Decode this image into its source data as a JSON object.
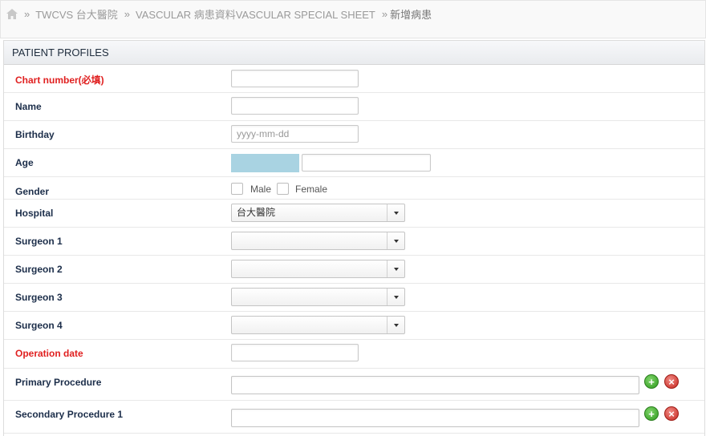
{
  "breadcrumb": {
    "items": [
      "TWCVS 台大醫院",
      "VASCULAR 病患資料VASCULAR SPECIAL SHEET"
    ],
    "current": "新增病患",
    "separator": "»"
  },
  "panel": {
    "title": "PATIENT PROFILES"
  },
  "fields": {
    "chart_number": {
      "label": "Chart number(必填)",
      "value": ""
    },
    "name": {
      "label": "Name",
      "value": ""
    },
    "birthday": {
      "label": "Birthday",
      "placeholder": "yyyy-mm-dd",
      "value": ""
    },
    "age": {
      "label": "Age",
      "value": ""
    },
    "gender": {
      "label": "Gender",
      "options": [
        "Male",
        "Female"
      ]
    },
    "hospital": {
      "label": "Hospital",
      "value": "台大醫院"
    },
    "surgeon1": {
      "label": "Surgeon 1",
      "value": ""
    },
    "surgeon2": {
      "label": "Surgeon 2",
      "value": ""
    },
    "surgeon3": {
      "label": "Surgeon 3",
      "value": ""
    },
    "surgeon4": {
      "label": "Surgeon 4",
      "value": ""
    },
    "operation_date": {
      "label": "Operation date",
      "value": ""
    },
    "primary_procedure": {
      "label": "Primary Procedure",
      "value": ""
    },
    "secondary_procedure1": {
      "label": "Secondary Procedure 1",
      "value": ""
    }
  },
  "icons": {
    "home": "home-icon",
    "add": "plus-icon",
    "remove": "x-icon"
  },
  "colors": {
    "required": "#e02020",
    "label": "#1c2e4a",
    "age_block": "#a9d3e2",
    "add": "#2e9a1d",
    "remove": "#c6261f"
  }
}
